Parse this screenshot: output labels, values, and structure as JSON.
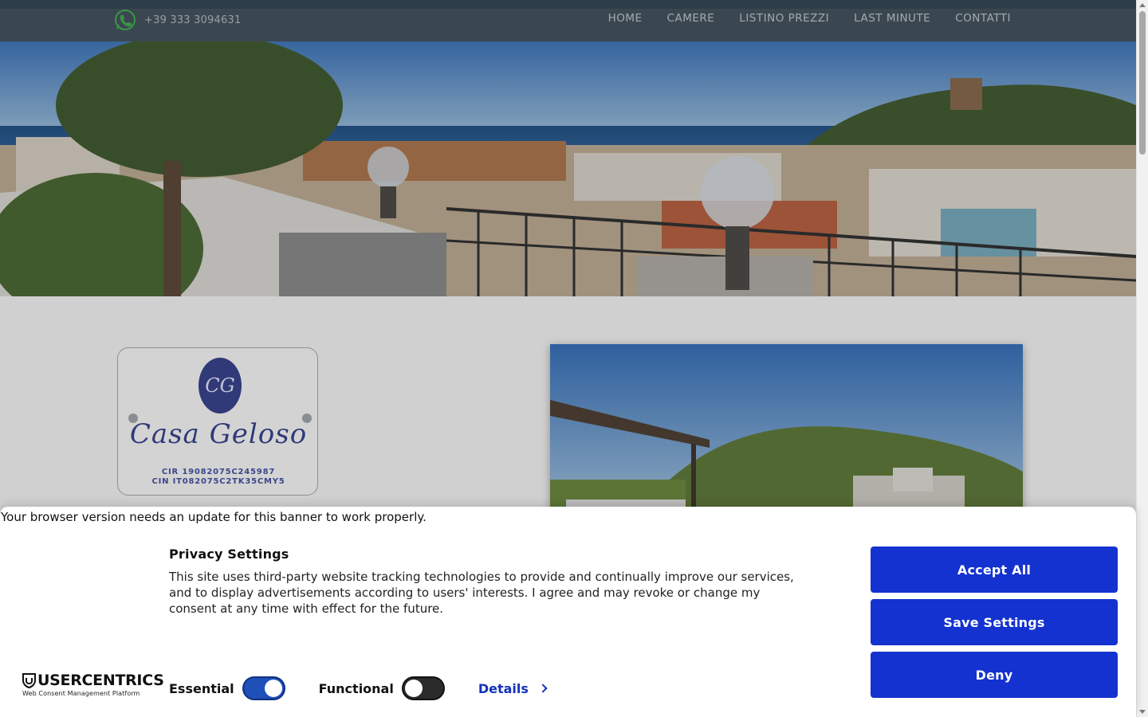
{
  "header": {
    "phone": "+39 333 3094631",
    "nav": [
      "HOME",
      "CAMERE",
      "LISTINO PREZZI",
      "LAST MINUTE",
      "CONTATTI"
    ]
  },
  "logo": {
    "monogram": "CG",
    "name": "Casa Geloso",
    "cir": "CIR 19082075C245987",
    "cin": "CIN IT082075C2TK35CMY5"
  },
  "banner": {
    "update_message": "Your browser version needs an update for this banner to work properly.",
    "title": "Privacy Settings",
    "text": "This site uses third-party website tracking technologies to provide and continually improve our services, and to display advertisements according to users' interests. I agree and may revoke or change my consent at any time with effect for the future.",
    "brand": "USERCENTRICS",
    "brand_sub": "Web Consent Management Platform",
    "essential_label": "Essential",
    "essential_on": true,
    "functional_label": "Functional",
    "functional_on": false,
    "details_label": "Details",
    "accept_label": "Accept All",
    "save_label": "Save Settings",
    "deny_label": "Deny"
  },
  "colors": {
    "nav_bg": "#3b4a55",
    "button_blue": "#1432cf",
    "toggle_on": "#1f4fb8",
    "logo_blue": "#2f3a86"
  },
  "icons": {
    "phone": "whatsapp-phone-icon",
    "details": "chevron-right-icon",
    "brand": "usercentrics-shield-icon"
  }
}
